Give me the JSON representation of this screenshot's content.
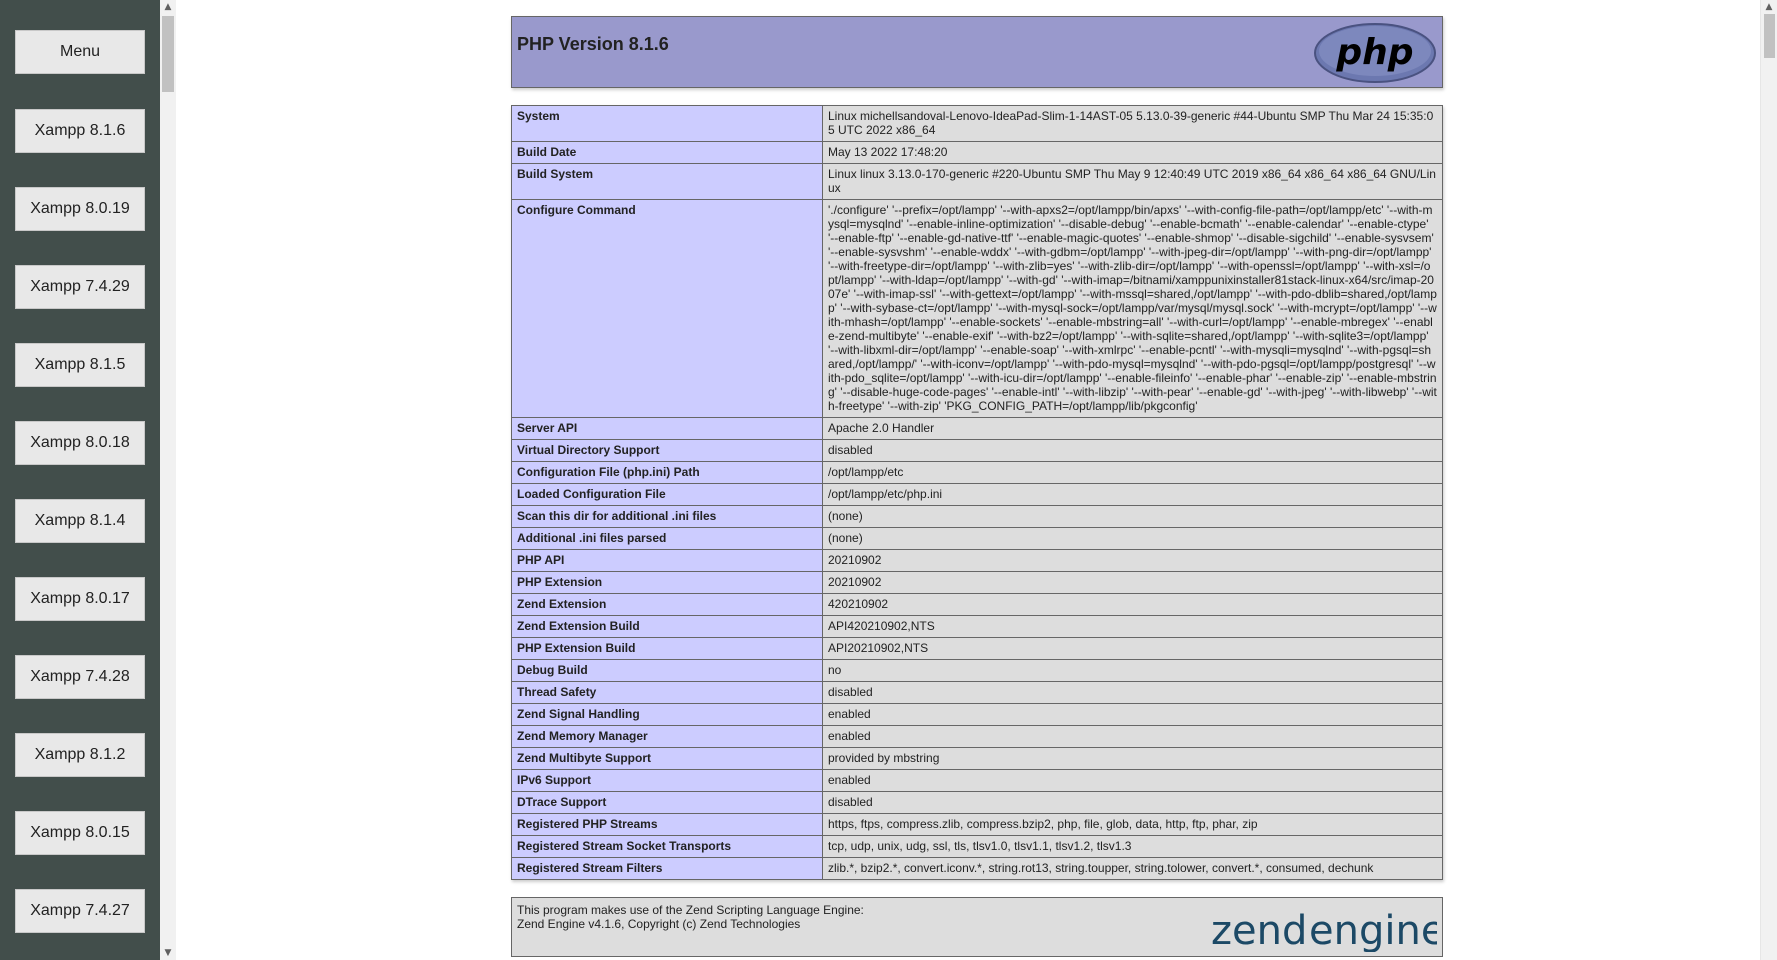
{
  "sidebar": {
    "buttons": [
      "Menu",
      "Xampp 8.1.6",
      "Xampp 8.0.19",
      "Xampp 7.4.29",
      "Xampp 8.1.5",
      "Xampp 8.0.18",
      "Xampp 8.1.4",
      "Xampp 8.0.17",
      "Xampp 7.4.28",
      "Xampp 8.1.2",
      "Xampp 8.0.15",
      "Xampp 7.4.27"
    ]
  },
  "header": {
    "title": "PHP Version 8.1.6",
    "logo_text": "php"
  },
  "info_rows": [
    {
      "key": "System",
      "value": "Linux michellsandoval-Lenovo-IdeaPad-Slim-1-14AST-05 5.13.0-39-generic #44-Ubuntu SMP Thu Mar 24 15:35:05 UTC 2022 x86_64"
    },
    {
      "key": "Build Date",
      "value": "May 13 2022 17:48:20"
    },
    {
      "key": "Build System",
      "value": "Linux linux 3.13.0-170-generic #220-Ubuntu SMP Thu May 9 12:40:49 UTC 2019 x86_64 x86_64 x86_64 GNU/Linux"
    },
    {
      "key": "Configure Command",
      "value": "'./configure' '--prefix=/opt/lampp' '--with-apxs2=/opt/lampp/bin/apxs' '--with-config-file-path=/opt/lampp/etc' '--with-mysql=mysqlnd' '--enable-inline-optimization' '--disable-debug' '--enable-bcmath' '--enable-calendar' '--enable-ctype' '--enable-ftp' '--enable-gd-native-ttf' '--enable-magic-quotes' '--enable-shmop' '--disable-sigchild' '--enable-sysvsem' '--enable-sysvshm' '--enable-wddx' '--with-gdbm=/opt/lampp' '--with-jpeg-dir=/opt/lampp' '--with-png-dir=/opt/lampp' '--with-freetype-dir=/opt/lampp' '--with-zlib=yes' '--with-zlib-dir=/opt/lampp' '--with-openssl=/opt/lampp' '--with-xsl=/opt/lampp' '--with-ldap=/opt/lampp' '--with-gd' '--with-imap=/bitnami/xamppunixinstaller81stack-linux-x64/src/imap-2007e' '--with-imap-ssl' '--with-gettext=/opt/lampp' '--with-mssql=shared,/opt/lampp' '--with-pdo-dblib=shared,/opt/lampp' '--with-sybase-ct=/opt/lampp' '--with-mysql-sock=/opt/lampp/var/mysql/mysql.sock' '--with-mcrypt=/opt/lampp' '--with-mhash=/opt/lampp' '--enable-sockets' '--enable-mbstring=all' '--with-curl=/opt/lampp' '--enable-mbregex' '--enable-zend-multibyte' '--enable-exif' '--with-bz2=/opt/lampp' '--with-sqlite=shared,/opt/lampp' '--with-sqlite3=/opt/lampp' '--with-libxml-dir=/opt/lampp' '--enable-soap' '--with-xmlrpc' '--enable-pcntl' '--with-mysqli=mysqlnd' '--with-pgsql=shared,/opt/lampp/' '--with-iconv=/opt/lampp' '--with-pdo-mysql=mysqlnd' '--with-pdo-pgsql=/opt/lampp/postgresql' '--with-pdo_sqlite=/opt/lampp' '--with-icu-dir=/opt/lampp' '--enable-fileinfo' '--enable-phar' '--enable-zip' '--enable-mbstring' '--disable-huge-code-pages' '--enable-intl' '--with-libzip' '--with-pear' '--enable-gd' '--with-jpeg' '--with-libwebp' '--with-freetype' '--with-zip' 'PKG_CONFIG_PATH=/opt/lampp/lib/pkgconfig'"
    },
    {
      "key": "Server API",
      "value": "Apache 2.0 Handler"
    },
    {
      "key": "Virtual Directory Support",
      "value": "disabled"
    },
    {
      "key": "Configuration File (php.ini) Path",
      "value": "/opt/lampp/etc"
    },
    {
      "key": "Loaded Configuration File",
      "value": "/opt/lampp/etc/php.ini"
    },
    {
      "key": "Scan this dir for additional .ini files",
      "value": "(none)"
    },
    {
      "key": "Additional .ini files parsed",
      "value": "(none)"
    },
    {
      "key": "PHP API",
      "value": "20210902"
    },
    {
      "key": "PHP Extension",
      "value": "20210902"
    },
    {
      "key": "Zend Extension",
      "value": "420210902"
    },
    {
      "key": "Zend Extension Build",
      "value": "API420210902,NTS"
    },
    {
      "key": "PHP Extension Build",
      "value": "API20210902,NTS"
    },
    {
      "key": "Debug Build",
      "value": "no"
    },
    {
      "key": "Thread Safety",
      "value": "disabled"
    },
    {
      "key": "Zend Signal Handling",
      "value": "enabled"
    },
    {
      "key": "Zend Memory Manager",
      "value": "enabled"
    },
    {
      "key": "Zend Multibyte Support",
      "value": "provided by mbstring"
    },
    {
      "key": "IPv6 Support",
      "value": "enabled"
    },
    {
      "key": "DTrace Support",
      "value": "disabled"
    },
    {
      "key": "Registered PHP Streams",
      "value": "https, ftps, compress.zlib, compress.bzip2, php, file, glob, data, http, ftp, phar, zip"
    },
    {
      "key": "Registered Stream Socket Transports",
      "value": "tcp, udp, unix, udg, ssl, tls, tlsv1.0, tlsv1.1, tlsv1.2, tlsv1.3"
    },
    {
      "key": "Registered Stream Filters",
      "value": "zlib.*, bzip2.*, convert.iconv.*, string.rot13, string.toupper, string.tolower, convert.*, consumed, dechunk"
    }
  ],
  "zend": {
    "line1": "This program makes use of the Zend Scripting Language Engine:",
    "line2": "Zend Engine v4.1.6, Copyright (c) Zend Technologies",
    "logo_text": "zend",
    "logo_text2": "engine"
  },
  "icons": {
    "scroll_up": "scroll-up-arrow-icon",
    "scroll_down": "scroll-down-arrow-icon"
  }
}
